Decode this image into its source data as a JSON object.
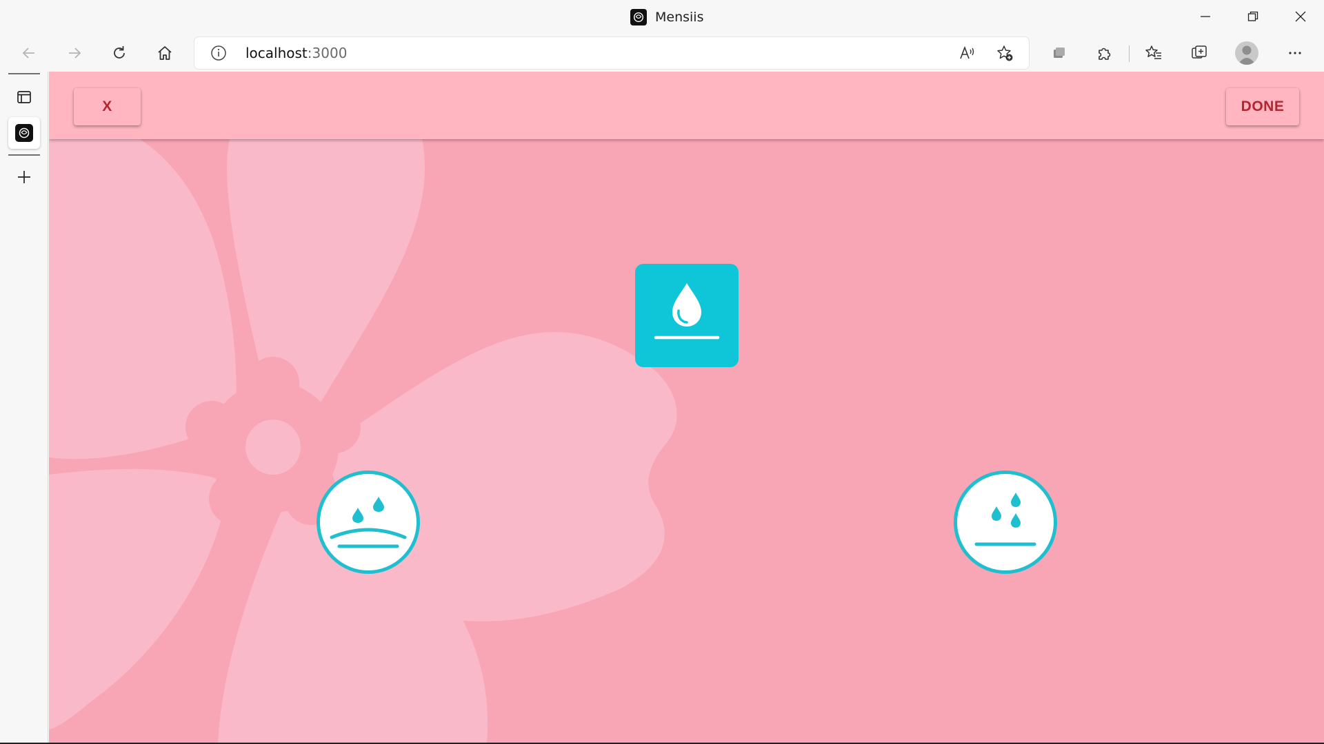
{
  "window": {
    "title": "Mensiis",
    "controls": [
      "minimize-icon",
      "restore-icon",
      "close-icon"
    ]
  },
  "toolbar": {
    "address_host": "localhost",
    "address_port": ":3000",
    "icons": [
      "back-icon",
      "forward-icon",
      "refresh-icon",
      "home-icon",
      "site-info-icon",
      "read-aloud-icon",
      "add-favorite-icon",
      "workspaces-icon",
      "extensions-icon",
      "favorites-icon",
      "collections-icon",
      "profile-icon",
      "more-icon"
    ]
  },
  "sidebar": {
    "icons": [
      "tab-actions-icon",
      "mensiis-tab-icon",
      "new-tab-icon"
    ]
  },
  "app": {
    "close_label": "X",
    "done_label": "DONE",
    "options": [
      {
        "icon": "blood-drop-icon",
        "selected": true
      },
      {
        "icon": "sad-face-tears-icon",
        "selected": false
      },
      {
        "icon": "neutral-face-tears-icon",
        "selected": false
      }
    ],
    "colors": {
      "background": "#f8a5b5",
      "header": "#ffb6c1",
      "accent": "#0fc5d8",
      "button_text": "#b3262f",
      "flower": "#f9b9c8"
    }
  }
}
